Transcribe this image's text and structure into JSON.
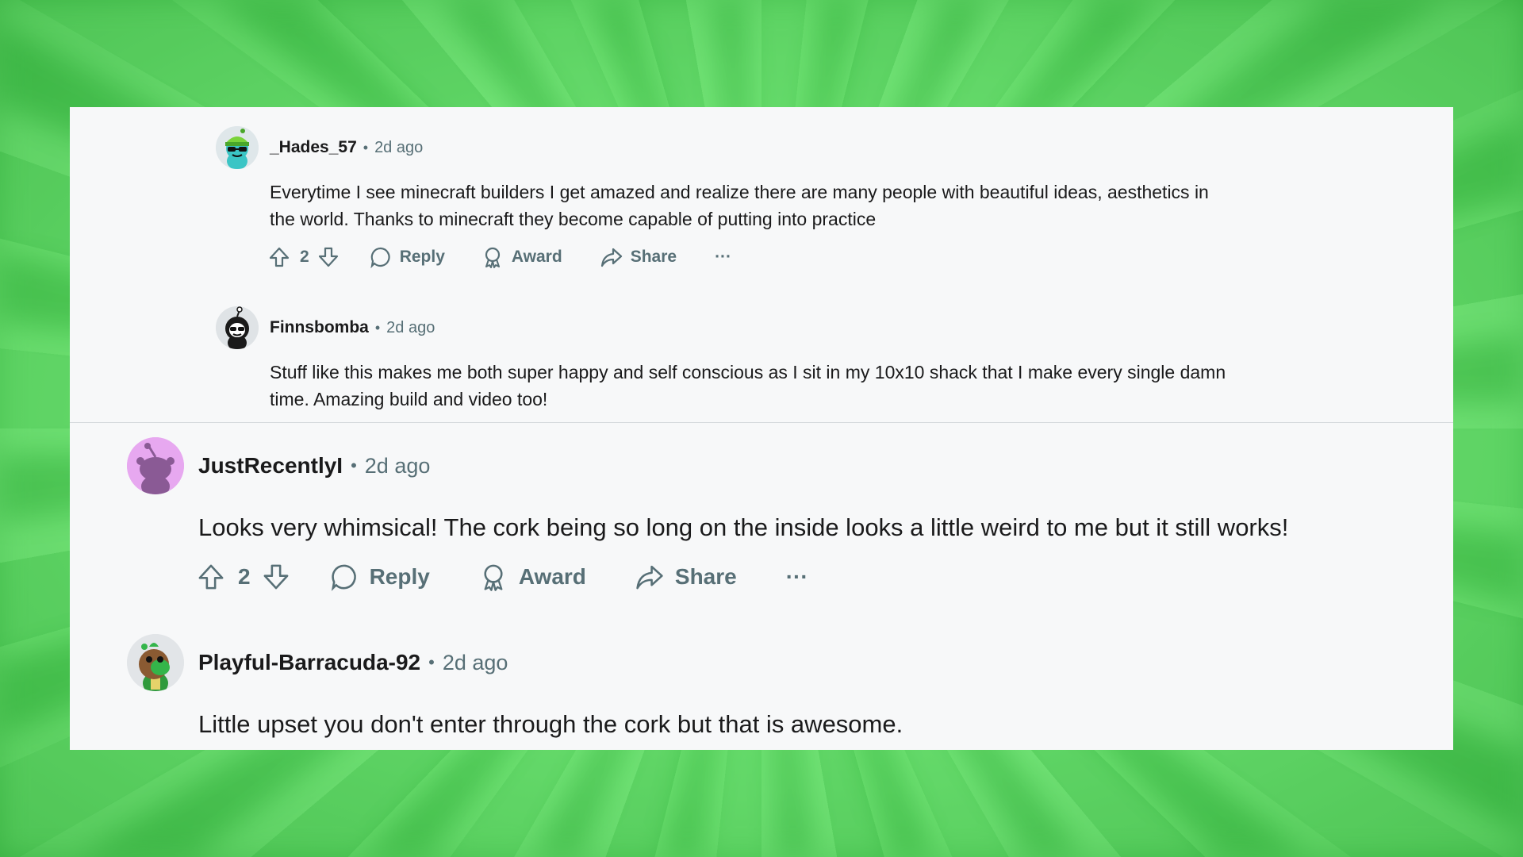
{
  "comments": [
    {
      "username": "_Hades_57",
      "time": "2d ago",
      "body": "Everytime I see minecraft builders I get amazed and realize there are many people with beautiful ideas, aesthetics in the world. Thanks to minecraft they become capable of putting into practice",
      "votes": "2",
      "reply_label": "Reply",
      "award_label": "Award",
      "share_label": "Share",
      "more_label": "···",
      "avatar_icon": "snoo-avatar-green-beanie-icon"
    },
    {
      "username": "Finnsbomba",
      "time": "2d ago",
      "body": "Stuff like this makes me both super happy and self conscious as I sit in my 10x10 shack that I make every single damn time. Amazing build and video too!",
      "avatar_icon": "snoo-avatar-black-hood-icon"
    },
    {
      "username": "JustRecentlyI",
      "time": "2d ago",
      "body": "Looks very whimsical! The cork being so long on the inside looks a little weird to me but it still works!",
      "votes": "2",
      "reply_label": "Reply",
      "award_label": "Award",
      "share_label": "Share",
      "more_label": "···",
      "avatar_icon": "snoo-avatar-default-purple-icon"
    },
    {
      "username": "Playful-Barracuda-92",
      "time": "2d ago",
      "body": "Little upset you don't enter through the cork but that is awesome.",
      "avatar_icon": "snoo-avatar-green-brown-icon"
    }
  ],
  "separator": "•",
  "colors": {
    "background_green": "#6fe86f",
    "card": "#f7f8f9",
    "text": "#1a1a1b",
    "meta": "#576f76",
    "avatar_purple": "#e7a8f0"
  }
}
